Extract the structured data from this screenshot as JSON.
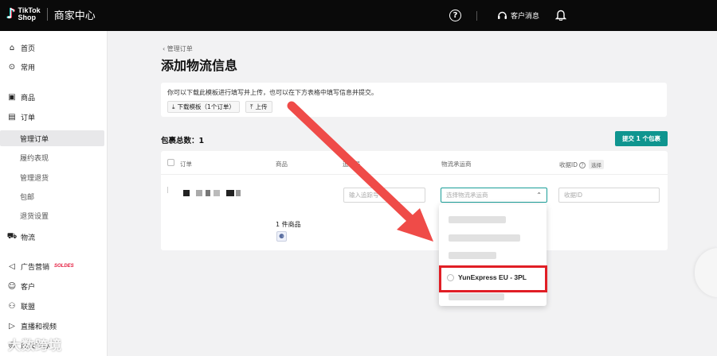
{
  "topbar": {
    "logo_text": "TikTok Shop",
    "title": "商家中心",
    "help_icon": "question-circle-icon",
    "messages_label": "客户消息",
    "bell_icon": "bell-icon"
  },
  "sidebar": {
    "items": [
      {
        "label": "首页",
        "icon": "home-icon"
      },
      {
        "label": "常用",
        "icon": "star-circle-icon"
      },
      {
        "label": "商品",
        "icon": "product-icon"
      },
      {
        "label": "订单",
        "icon": "order-icon"
      },
      {
        "label": "管理订单"
      },
      {
        "label": "履约表现"
      },
      {
        "label": "管理退货"
      },
      {
        "label": "包邮"
      },
      {
        "label": "退货设置"
      },
      {
        "label": "物流",
        "icon": "truck-icon"
      },
      {
        "label": "广告营销",
        "icon": "megaphone-icon",
        "badge": "SOLDES"
      },
      {
        "label": "客户",
        "icon": "customer-icon"
      },
      {
        "label": "联盟",
        "icon": "alliance-icon"
      },
      {
        "label": "直播和视频",
        "icon": "live-icon"
      },
      {
        "label": "成长中心",
        "icon": "growth-icon"
      }
    ]
  },
  "main": {
    "breadcrumb": "管理订单",
    "title": "添加物流信息",
    "info_text": "你可以下载此模板进行填写并上传，也可以在下方表格中填写信息并提交。",
    "download_label": "下载模板（1个订单）",
    "upload_label": "上传",
    "package_count_label": "包裹总数：1",
    "submit_label": "提交 1 个包裹"
  },
  "table": {
    "headers": [
      "订单",
      "商品",
      "追踪号",
      "物流承运商",
      "收据ID",
      "选择"
    ],
    "row": {
      "qty": "1 件商品",
      "tracking_placeholder": "输入追踪号",
      "carrier_placeholder": "选择物流承运商",
      "receipt_placeholder": "收据ID"
    }
  },
  "dropdown": {
    "highlighted_option": "YunExpress EU - 3PL"
  },
  "watermark": "大数跨境",
  "colors": {
    "accent": "#0f958f",
    "highlight": "#e01e25",
    "arrow": "#ef4b48"
  }
}
